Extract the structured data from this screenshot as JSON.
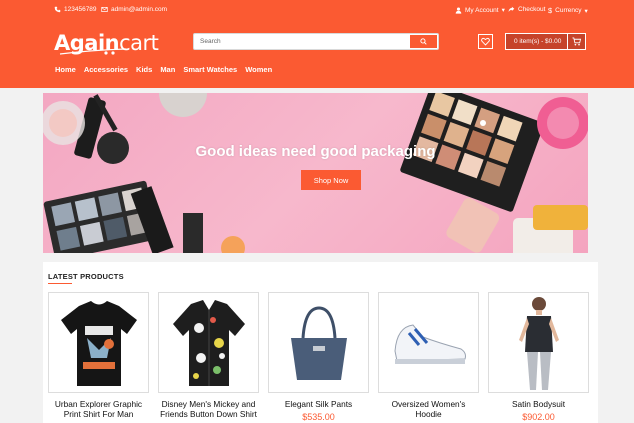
{
  "topbar": {
    "phone": "123456789",
    "email": "admin@admin.com",
    "account": "My Account",
    "checkout": "Checkout",
    "currency": "Currency"
  },
  "logo": {
    "part1": "Again",
    "part2": "cart"
  },
  "search": {
    "placeholder": "Search"
  },
  "cart": {
    "label": "0 item(s) - $0.00"
  },
  "nav": [
    "Home",
    "Accessories",
    "Kids",
    "Man",
    "Smart Watches",
    "Women"
  ],
  "banner": {
    "title": "Good ideas need good packaging",
    "button": "Shop Now"
  },
  "products": {
    "title": "LATEST PRODUCTS",
    "items": [
      {
        "name": "Urban Explorer Graphic Print Shirt For Man",
        "price": ""
      },
      {
        "name": "Disney Men's Mickey and Friends Button Down Shirt",
        "price": ""
      },
      {
        "name": "Elegant Silk Pants",
        "price": "$535.00"
      },
      {
        "name": "Oversized Women's Hoodie",
        "price": ""
      },
      {
        "name": "Satin Bodysuit",
        "price": "$902.00"
      }
    ]
  },
  "colors": {
    "brand": "#fb5a32",
    "cart_bg": "#c6432a"
  },
  "icons": [
    "phone-icon",
    "mail-icon",
    "user-icon",
    "share-icon",
    "dollar-icon",
    "search-icon",
    "heart-icon",
    "cart-icon"
  ]
}
